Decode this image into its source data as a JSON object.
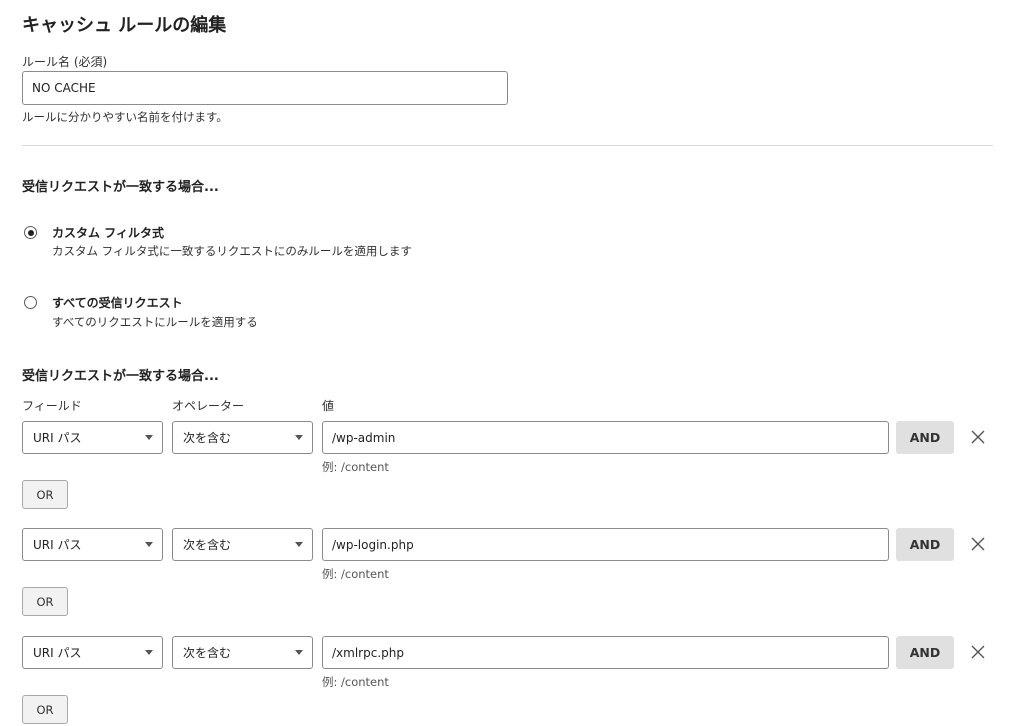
{
  "page": {
    "title": "キャッシュ ルールの編集"
  },
  "rule_name": {
    "label": "ルール名 (必須)",
    "value": "NO CACHE",
    "help": "ルールに分かりやすい名前を付けます。"
  },
  "match": {
    "heading": "受信リクエストが一致する場合...",
    "selected": "custom",
    "options": [
      {
        "id": "custom",
        "title": "カスタム フィルタ式",
        "description": "カスタム フィルタ式に一致するリクエストにのみルールを適用します"
      },
      {
        "id": "all",
        "title": "すべての受信リクエスト",
        "description": "すべてのリクエストにルールを適用する"
      }
    ]
  },
  "expression": {
    "heading": "受信リクエストが一致する場合...",
    "columns": {
      "field": "フィールド",
      "operator": "オペレーター",
      "value": "値"
    },
    "rows": [
      {
        "field": "URI パス",
        "operator": "次を含む",
        "value": "/wp-admin",
        "hint": "例: /content",
        "and_label": "AND",
        "or_label": "OR"
      },
      {
        "field": "URI パス",
        "operator": "次を含む",
        "value": "/wp-login.php",
        "hint": "例: /content",
        "and_label": "AND",
        "or_label": "OR"
      },
      {
        "field": "URI パス",
        "operator": "次を含む",
        "value": "/xmlrpc.php",
        "hint": "例: /content",
        "and_label": "AND",
        "or_label": "OR"
      }
    ]
  },
  "icons": {
    "remove": "close-icon",
    "dropdown": "chevron-down-icon"
  }
}
